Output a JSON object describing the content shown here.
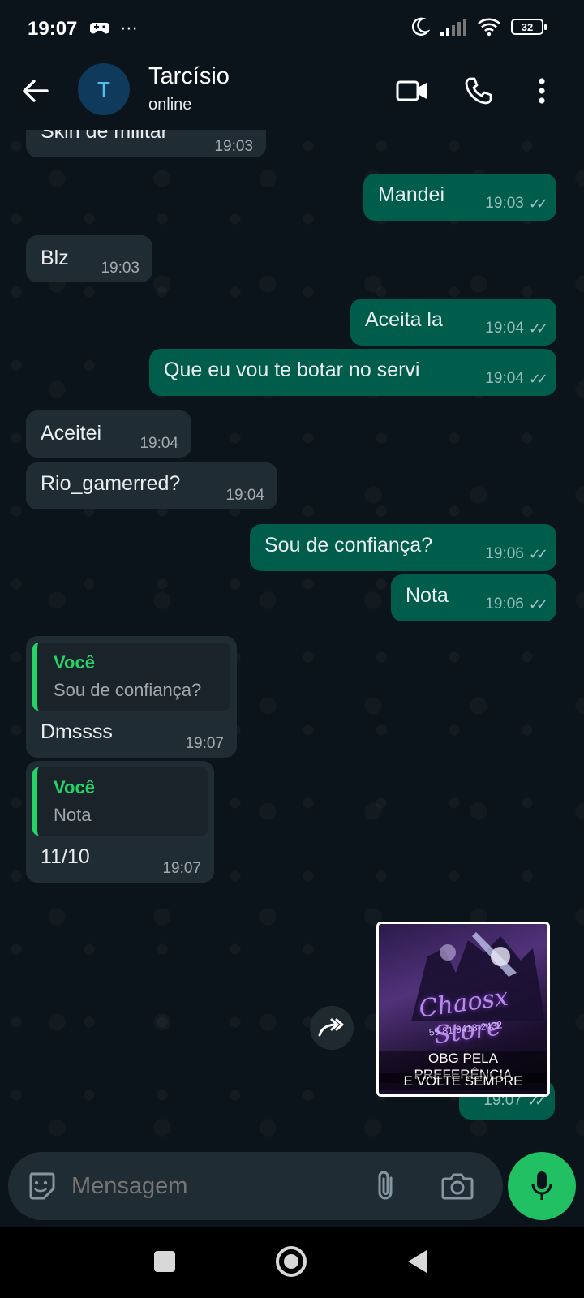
{
  "status_bar": {
    "time": "19:07",
    "battery": "32"
  },
  "header": {
    "avatar_initial": "T",
    "contact_name": "Tarcísio",
    "contact_status": "online"
  },
  "messages": [
    {
      "direction": "in",
      "text": "Skin de militar",
      "time": "19:03"
    },
    {
      "direction": "out",
      "text": "Mandei",
      "time": "19:03",
      "status": "read"
    },
    {
      "direction": "in",
      "text": "Blz",
      "time": "19:03"
    },
    {
      "direction": "out",
      "text": "Aceita la",
      "time": "19:04",
      "status": "read"
    },
    {
      "direction": "out",
      "text": "Que eu vou te botar no servi",
      "time": "19:04",
      "status": "read"
    },
    {
      "direction": "in",
      "text": "Aceitei",
      "time": "19:04"
    },
    {
      "direction": "in",
      "text": "Rio_gamerred?",
      "time": "19:04"
    },
    {
      "direction": "out",
      "text": "Sou de confiança?",
      "time": "19:06",
      "status": "read"
    },
    {
      "direction": "out",
      "text": "Nota",
      "time": "19:06",
      "status": "read"
    },
    {
      "direction": "in",
      "text": "Dmssss",
      "time": "19:07",
      "quote": {
        "author": "Você",
        "text": "Sou de confiança?"
      }
    },
    {
      "direction": "in",
      "text": "11/10",
      "time": "19:07",
      "quote": {
        "author": "Você",
        "text": "Nota"
      }
    },
    {
      "direction": "out",
      "type": "image",
      "time": "19:07",
      "status": "read",
      "image": {
        "brand": "Chaosx Store",
        "sub": "55 81 9418-2432",
        "caption_line1": "OBG PELA PREFERÊNCIA",
        "caption_line2": "E VOLTE SEMPRE"
      }
    }
  ],
  "composer": {
    "placeholder": "Mensagem"
  },
  "colors": {
    "background": "#0b141a",
    "incoming_bubble": "#202c33",
    "outgoing_bubble": "#005c4b",
    "accent_green": "#25d366",
    "mic_button": "#21c063"
  }
}
